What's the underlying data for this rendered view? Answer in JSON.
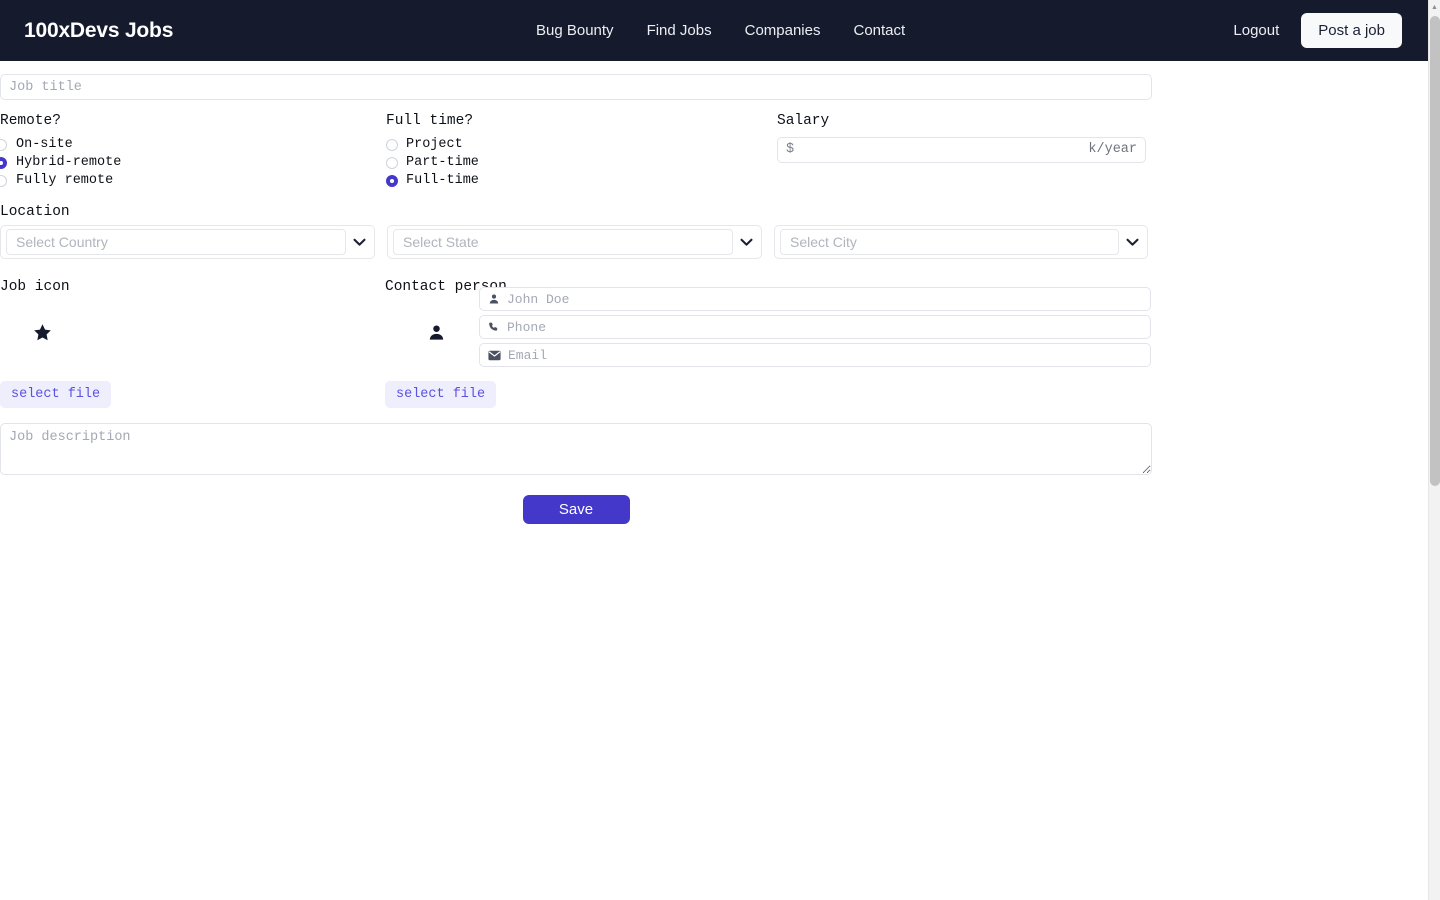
{
  "header": {
    "brand": "100xDevs Jobs",
    "nav": [
      {
        "label": "Bug Bounty",
        "name": "nav-bug-bounty"
      },
      {
        "label": "Find Jobs",
        "name": "nav-find-jobs"
      },
      {
        "label": "Companies",
        "name": "nav-companies"
      },
      {
        "label": "Contact",
        "name": "nav-contact"
      }
    ],
    "logout_label": "Logout",
    "post_job_label": "Post a job"
  },
  "form": {
    "job_title_placeholder": "Job title",
    "remote": {
      "legend": "Remote?",
      "options": [
        {
          "label": "On-site",
          "checked": false
        },
        {
          "label": "Hybrid-remote",
          "checked": true
        },
        {
          "label": "Fully remote",
          "checked": false
        }
      ],
      "selected": "Hybrid-remote"
    },
    "fulltime": {
      "legend": "Full time?",
      "options": [
        {
          "label": "Project",
          "checked": false
        },
        {
          "label": "Part-time",
          "checked": false
        },
        {
          "label": "Full-time",
          "checked": true
        }
      ],
      "selected": "Full-time"
    },
    "salary": {
      "legend": "Salary",
      "currency_symbol": "$",
      "value": "",
      "placeholder": "",
      "unit": "k/year"
    },
    "location": {
      "legend": "Location",
      "country_placeholder": "Select Country",
      "state_placeholder": "Select State",
      "city_placeholder": "Select City",
      "country_value": "",
      "state_value": "",
      "city_value": ""
    },
    "job_icon": {
      "legend": "Job icon",
      "icon": "star-icon",
      "select_file_label": "select file"
    },
    "contact_person": {
      "legend": "Contact person",
      "avatar_icon": "person-icon",
      "fields": [
        {
          "icon": "person-icon",
          "placeholder": "John Doe",
          "value": "",
          "name": "contact-name-input"
        },
        {
          "icon": "phone-icon",
          "placeholder": "Phone",
          "value": "",
          "name": "contact-phone-input"
        },
        {
          "icon": "envelope-icon",
          "placeholder": "Email",
          "value": "",
          "name": "contact-email-input"
        }
      ],
      "select_file_label": "select file"
    },
    "description_placeholder": "Job description",
    "description_value": "",
    "save_label": "Save"
  },
  "colors": {
    "header_bg": "#151a2d",
    "accent": "#4338ca",
    "file_btn_bg": "#eeeefc",
    "file_btn_text": "#5b51e0",
    "placeholder": "#a3a8b4"
  }
}
